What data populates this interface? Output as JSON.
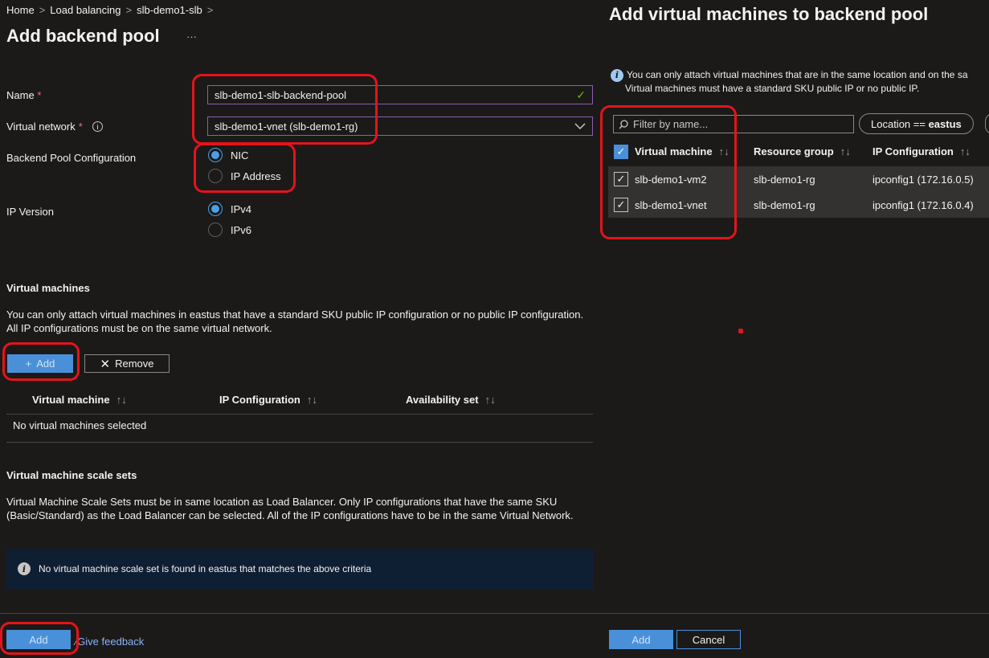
{
  "breadcrumb": [
    "Home",
    "Load balancing",
    "slb-demo1-slb"
  ],
  "page_title": "Add backend pool",
  "more_label": "···",
  "form": {
    "name_label": "Name",
    "name_value": "slb-demo1-slb-backend-pool",
    "vnet_label": "Virtual network",
    "vnet_value": "slb-demo1-vnet (slb-demo1-rg)",
    "pool_config_label": "Backend Pool Configuration",
    "pool_config_options": [
      "NIC",
      "IP Address"
    ],
    "pool_config_selected": "NIC",
    "ip_version_label": "IP Version",
    "ip_version_options": [
      "IPv4",
      "IPv6"
    ],
    "ip_version_selected": "IPv4",
    "required_mark": "*"
  },
  "vm_section": {
    "title": "Virtual machines",
    "description_1": "You can only attach virtual machines in eastus that have a standard SKU public IP configuration or no public IP configuration.",
    "description_2": "All IP configurations must be on the same virtual network.",
    "add_label": "Add",
    "remove_label": "Remove",
    "columns": [
      "Virtual machine",
      "IP Configuration",
      "Availability set"
    ],
    "empty_text": "No virtual machines selected"
  },
  "vmss_section": {
    "title": "Virtual machine scale sets",
    "description_1": "Virtual Machine Scale Sets must be in same location as Load Balancer. Only IP configurations that have the same SKU",
    "description_2": "(Basic/Standard) as the Load Balancer can be selected. All of the IP configurations have to be in the same Virtual Network.",
    "info_text": "No virtual machine scale set is found in eastus that matches the above criteria"
  },
  "footer": {
    "add_label": "Add",
    "feedback_label": "Give feedback"
  },
  "panel": {
    "title": "Add virtual machines to backend pool",
    "info_1": "You can only attach virtual machines that are in the same location and on the sa",
    "info_2": "Virtual machines must have a standard SKU public IP or no public IP.",
    "filter_placeholder": "Filter by name...",
    "location_filter_key": "Location ==",
    "location_filter_value": "eastus",
    "columns": [
      "Virtual machine",
      "Resource group",
      "IP Configuration"
    ],
    "rows": [
      {
        "vm": "slb-demo1-vm2",
        "rg": "slb-demo1-rg",
        "ip": "ipconfig1 (172.16.0.5)",
        "checked": true
      },
      {
        "vm": "slb-demo1-vnet",
        "rg": "slb-demo1-rg",
        "ip": "ipconfig1 (172.16.0.4)",
        "checked": true
      }
    ],
    "add_label": "Add",
    "cancel_label": "Cancel"
  },
  "colors": {
    "accent": "#4a90d9",
    "highlight": "#e3141b",
    "background": "#1b1a19"
  }
}
